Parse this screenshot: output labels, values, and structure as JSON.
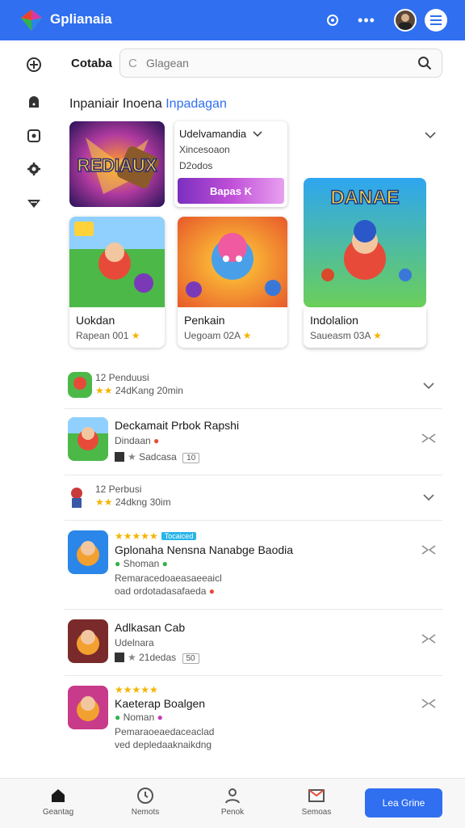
{
  "topbar": {
    "title": "Gplianaia",
    "accent": "#2f6ff0"
  },
  "rail": {
    "icons": [
      "add-circle-icon",
      "lock-icon",
      "puzzle-icon",
      "gear-icon",
      "shield-down-icon"
    ]
  },
  "header": {
    "section_label": "Cotaba",
    "search_placeholder": "Glagean",
    "heading_main": "Inpaniair Inoena",
    "heading_link": "Inpadagan"
  },
  "featured": {
    "hero_art_text": "REDIAUX",
    "dropdown": {
      "title": "Udelvamandia",
      "line1": "Xincesoaon",
      "line2": "D2odos",
      "banner": "Bapas K"
    },
    "tall_art_text": "DANAE",
    "tiles": [
      {
        "name": "Uokdan",
        "meta": "Rapean 001"
      },
      {
        "name": "Penkain",
        "meta": "Uegoam 02A"
      },
      {
        "name": "Indolalion",
        "meta": "Saueasm 03A"
      }
    ]
  },
  "list": [
    {
      "title": "",
      "line1": "12  Penduusi",
      "line2": "24dKang 20min",
      "kind": "compact"
    },
    {
      "title": "Deckamait Prbok Rapshi",
      "line1": "Dindaan",
      "line2": "Sadcasa",
      "tag": "10",
      "kind": "full"
    },
    {
      "title": "",
      "line1": "12  Perbusi",
      "line2": "24dkng 30im",
      "kind": "compact"
    },
    {
      "title": "Gplonaha Nensna Nanabge Baodia",
      "line1": "Shoman",
      "line2": "Remaracedoaeasaeeaicl",
      "line3": "oad ordotadasafaeda",
      "ribbon": "Tocaiced",
      "kind": "rated"
    },
    {
      "title": "Adlkasan Cab",
      "line1": "Udelnara",
      "line2": "21dedas",
      "tag": "50",
      "kind": "full"
    },
    {
      "title": "Kaeterap Boalgen",
      "line1": "Noman",
      "line2": "Pemaraoeaedaceaclad",
      "line3": "ved depledaaknaikdng",
      "kind": "rated"
    }
  ],
  "bottom_nav": [
    {
      "label": "Geantag",
      "icon": "home-icon"
    },
    {
      "label": "Nemots",
      "icon": "clock-icon"
    },
    {
      "label": "Penok",
      "icon": "person-icon"
    },
    {
      "label": "Semoas",
      "icon": "mail-icon"
    }
  ],
  "cta_label": "Lea Grine"
}
